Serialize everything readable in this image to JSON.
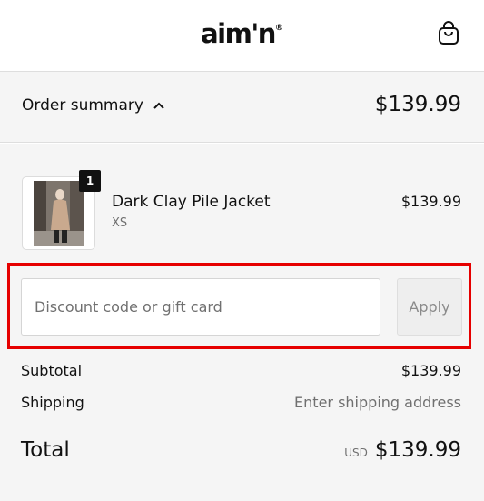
{
  "header": {
    "logo_text": "aim'n",
    "logo_mark": "®",
    "cart_icon": "shopping-bag-icon"
  },
  "summary": {
    "toggle_label": "Order summary",
    "toggle_icon": "chevron-up-icon",
    "total": "$139.99"
  },
  "line_item": {
    "quantity": "1",
    "name": "Dark Clay Pile Jacket",
    "variant": "XS",
    "price": "$139.99"
  },
  "discount": {
    "placeholder": "Discount code or gift card",
    "value": "",
    "apply_label": "Apply"
  },
  "totals": {
    "subtotal_label": "Subtotal",
    "subtotal_value": "$139.99",
    "shipping_label": "Shipping",
    "shipping_value": "Enter shipping address",
    "total_label": "Total",
    "currency": "USD",
    "total_value": "$139.99"
  },
  "colors": {
    "highlight": "#e60000",
    "panel_bg": "#f5f5f5"
  }
}
